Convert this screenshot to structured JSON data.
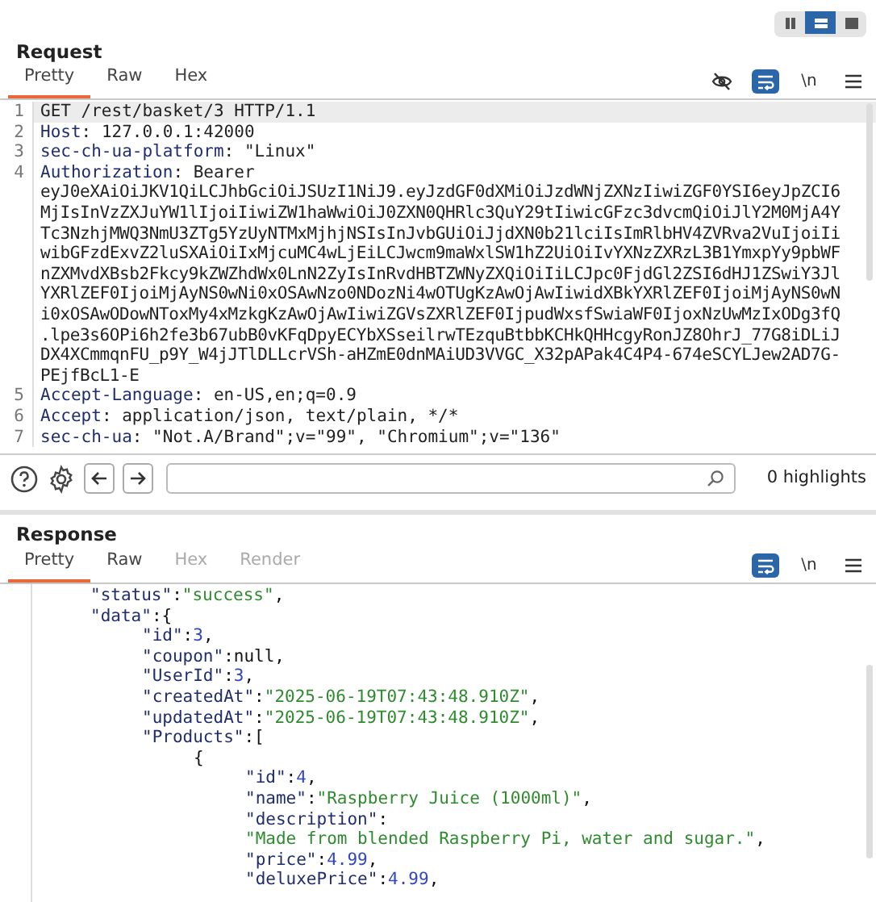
{
  "layout_toggle": [
    {
      "kind": "columns",
      "selected": false
    },
    {
      "kind": "rows",
      "selected": true
    },
    {
      "kind": "single",
      "selected": false
    }
  ],
  "request": {
    "title": "Request",
    "tabs": [
      {
        "label": "Pretty",
        "selected": true,
        "disabled": false
      },
      {
        "label": "Raw",
        "selected": false,
        "disabled": false
      },
      {
        "label": "Hex",
        "selected": false,
        "disabled": false
      }
    ],
    "toolbar": [
      {
        "kind": "hide",
        "selected": false
      },
      {
        "kind": "wrap",
        "selected": true
      },
      {
        "kind": "newline",
        "label": "\\n",
        "selected": false
      },
      {
        "kind": "menu",
        "selected": false
      }
    ],
    "lines": [
      {
        "number": "1",
        "text": "GET /rest/basket/3 HTTP/1.1",
        "selected": true
      },
      {
        "number": "2",
        "name": "Host",
        "text": ": 127.0.0.1:42000",
        "selected": false
      },
      {
        "number": "3",
        "name": "sec-ch-ua-platform",
        "text": ": \"Linux\"",
        "selected": false
      },
      {
        "number": "4",
        "name": "Authorization",
        "text": ": Bearer",
        "selected": false,
        "wrapped": [
          "eyJ0eXAiOiJKV1QiLCJhbGciOiJSUzI1NiJ9.eyJzdGF0dXMiOiJzdWNjZXNzIiwiZGF0YSI6eyJpZCI6",
          "MjIsInVzZXJuYW1lIjoiIiwiZW1haWwiOiJ0ZXN0QHRlc3QuY29tIiwicGFzc3dvcmQiOiJlY2M0MjA4Y",
          "Tc3NzhjMWQ3NmU3ZTg5YzUyNTMxMjhjNSIsInJvbGUiOiJjdXN0b21lciIsImRlbHV4ZVRva2VuIjoiIi",
          "wibGFzdExvZ2luSXAiOiIxMjcuMC4wLjEiLCJwcm9maWxlSW1hZ2UiOiIvYXNzZXRzL3B1YmxpYy9pbWF",
          "nZXMvdXBsb2Fkcy9kZWZhdWx0LnN2ZyIsInRvdHBTZWNyZXQiOiIiLCJpc0FjdGl2ZSI6dHJ1ZSwiY3Jl",
          "YXRlZEF0IjoiMjAyNS0wNi0xOSAwNzo0NDozNi4wOTUgKzAwOjAwIiwidXBkYXRlZEF0IjoiMjAyNS0wN",
          "i0xOSAwODowNToxMy4xMzkgKzAwOjAwIiwiZGVsZXRlZEF0IjpudWxsfSwiaWF0IjoxNzUwMzIxODg3fQ",
          ".lpe3s6OPi6h2fe3b67ubB0vKFqDpyECYbXSseilrwTEzquBtbbKCHkQHHcgyRonJZ8OhrJ_77G8iDLiJ",
          "DX4XCmmqnFU_p9Y_W4jJTlDLLcrVSh-aHZmE0dnMAiUD3VVGC_X32pAPak4C4P4-674eSCYLJew2AD7G-",
          "PEjfBcL1-E"
        ]
      },
      {
        "number": "5",
        "name": "Accept-Language",
        "text": ": en-US,en;q=0.9",
        "selected": false
      },
      {
        "number": "6",
        "name": "Accept",
        "text": ": application/json, text/plain, */*",
        "selected": false
      },
      {
        "number": "7",
        "name": "sec-ch-ua",
        "text": ": \"Not.A/Brand\";v=\"99\", \"Chromium\";v=\"136\"",
        "selected": false
      }
    ]
  },
  "search_bar": {
    "highlights": "0 highlights"
  },
  "response": {
    "title": "Response",
    "tabs": [
      {
        "label": "Pretty",
        "selected": true,
        "disabled": false
      },
      {
        "label": "Raw",
        "selected": false,
        "disabled": false
      },
      {
        "label": "Hex",
        "selected": false,
        "disabled": true
      },
      {
        "label": "Render",
        "selected": false,
        "disabled": true
      }
    ],
    "toolbar": [
      {
        "kind": "wrap",
        "selected": true
      },
      {
        "kind": "newline",
        "label": "\\n",
        "selected": false
      },
      {
        "kind": "menu",
        "selected": false
      }
    ],
    "lines": [
      {
        "parts": [
          {
            "kind": "key",
            "text": "\"status\""
          },
          {
            "kind": "punct",
            "text": ":"
          },
          {
            "kind": "string",
            "text": "\"success\""
          },
          {
            "kind": "punct",
            "text": ","
          }
        ]
      },
      {
        "parts": [
          {
            "kind": "key",
            "text": "\"data\""
          },
          {
            "kind": "punct",
            "text": ":{"
          }
        ],
        "children": [
          {
            "parts": [
              {
                "kind": "key",
                "text": "\"id\""
              },
              {
                "kind": "punct",
                "text": ":"
              },
              {
                "kind": "number",
                "text": "3"
              },
              {
                "kind": "punct",
                "text": ","
              }
            ]
          },
          {
            "parts": [
              {
                "kind": "key",
                "text": "\"coupon\""
              },
              {
                "kind": "punct",
                "text": ":null,"
              }
            ]
          },
          {
            "parts": [
              {
                "kind": "key",
                "text": "\"UserId\""
              },
              {
                "kind": "punct",
                "text": ":"
              },
              {
                "kind": "number",
                "text": "3"
              },
              {
                "kind": "punct",
                "text": ","
              }
            ]
          },
          {
            "parts": [
              {
                "kind": "key",
                "text": "\"createdAt\""
              },
              {
                "kind": "punct",
                "text": ":"
              },
              {
                "kind": "string",
                "text": "\"2025-06-19T07:43:48.910Z\""
              },
              {
                "kind": "punct",
                "text": ","
              }
            ]
          },
          {
            "parts": [
              {
                "kind": "key",
                "text": "\"updatedAt\""
              },
              {
                "kind": "punct",
                "text": ":"
              },
              {
                "kind": "string",
                "text": "\"2025-06-19T07:43:48.910Z\""
              },
              {
                "kind": "punct",
                "text": ","
              }
            ]
          },
          {
            "parts": [
              {
                "kind": "key",
                "text": "\"Products\""
              },
              {
                "kind": "punct",
                "text": ":["
              }
            ],
            "children": [
              {
                "parts": [
                  {
                    "kind": "punct",
                    "text": "{"
                  }
                ],
                "children": [
                  {
                    "parts": [
                      {
                        "kind": "key",
                        "text": "\"id\""
                      },
                      {
                        "kind": "punct",
                        "text": ":"
                      },
                      {
                        "kind": "number",
                        "text": "4"
                      },
                      {
                        "kind": "punct",
                        "text": ","
                      }
                    ]
                  },
                  {
                    "parts": [
                      {
                        "kind": "key",
                        "text": "\"name\""
                      },
                      {
                        "kind": "punct",
                        "text": ":"
                      },
                      {
                        "kind": "string",
                        "text": "\"Raspberry Juice (1000ml)\""
                      },
                      {
                        "kind": "punct",
                        "text": ","
                      }
                    ]
                  },
                  {
                    "parts": [
                      {
                        "kind": "key",
                        "text": "\"description\""
                      },
                      {
                        "kind": "punct",
                        "text": ":"
                      }
                    ]
                  },
                  {
                    "parts": [
                      {
                        "kind": "string",
                        "text": "\"Made from blended Raspberry Pi, water and sugar.\""
                      },
                      {
                        "kind": "punct",
                        "text": ","
                      }
                    ]
                  },
                  {
                    "parts": [
                      {
                        "kind": "key",
                        "text": "\"price\""
                      },
                      {
                        "kind": "punct",
                        "text": ":"
                      },
                      {
                        "kind": "number",
                        "text": "4.99"
                      },
                      {
                        "kind": "punct",
                        "text": ","
                      }
                    ]
                  },
                  {
                    "parts": [
                      {
                        "kind": "key",
                        "text": "\"deluxePrice\""
                      },
                      {
                        "kind": "punct",
                        "text": ":"
                      },
                      {
                        "kind": "number",
                        "text": "4.99"
                      },
                      {
                        "kind": "punct",
                        "text": ","
                      }
                    ]
                  }
                ]
              }
            ]
          }
        ]
      }
    ]
  }
}
